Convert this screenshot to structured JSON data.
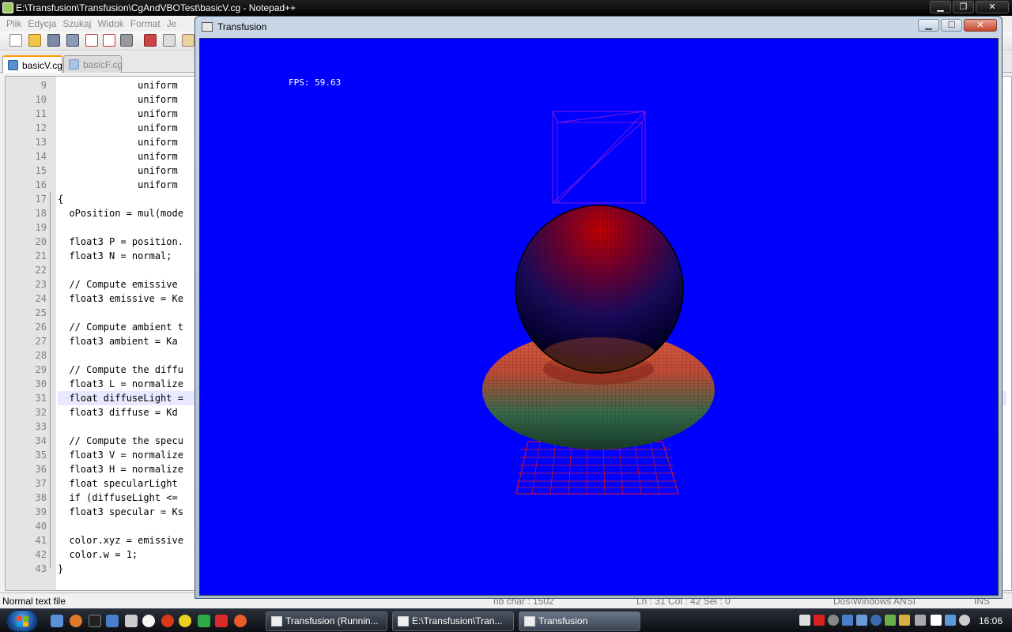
{
  "notepad": {
    "title": "E:\\Transfusion\\Transfusion\\CgAndVBOTest\\basicV.cg - Notepad++",
    "menu": [
      "Plik",
      "Edycja",
      "Szukaj",
      "Widok",
      "Format",
      "Je"
    ],
    "tabs": [
      {
        "label": "basicV.cg",
        "active": true
      },
      {
        "label": "basicF.cg",
        "active": false
      }
    ],
    "lines": [
      {
        "n": "9",
        "text": "              uniform"
      },
      {
        "n": "10",
        "text": "              uniform"
      },
      {
        "n": "11",
        "text": "              uniform"
      },
      {
        "n": "12",
        "text": "              uniform"
      },
      {
        "n": "13",
        "text": "              uniform"
      },
      {
        "n": "14",
        "text": "              uniform"
      },
      {
        "n": "15",
        "text": "              uniform"
      },
      {
        "n": "16",
        "text": "              uniform"
      },
      {
        "n": "17",
        "text": "{"
      },
      {
        "n": "18",
        "text": "  oPosition = mul(mode"
      },
      {
        "n": "19",
        "text": ""
      },
      {
        "n": "20",
        "text": "  float3 P = position."
      },
      {
        "n": "21",
        "text": "  float3 N = normal;"
      },
      {
        "n": "22",
        "text": ""
      },
      {
        "n": "23",
        "text": "  // Compute emissive"
      },
      {
        "n": "24",
        "text": "  float3 emissive = Ke"
      },
      {
        "n": "25",
        "text": ""
      },
      {
        "n": "26",
        "text": "  // Compute ambient t"
      },
      {
        "n": "27",
        "text": "  float3 ambient = Ka"
      },
      {
        "n": "28",
        "text": ""
      },
      {
        "n": "29",
        "text": "  // Compute the diffu"
      },
      {
        "n": "30",
        "text": "  float3 L = normalize"
      },
      {
        "n": "31",
        "text": "  float diffuseLight ="
      },
      {
        "n": "32",
        "text": "  float3 diffuse = Kd"
      },
      {
        "n": "33",
        "text": ""
      },
      {
        "n": "34",
        "text": "  // Compute the specu"
      },
      {
        "n": "35",
        "text": "  float3 V = normalize"
      },
      {
        "n": "36",
        "text": "  float3 H = normalize"
      },
      {
        "n": "37",
        "text": "  float specularLight"
      },
      {
        "n": "38",
        "text": "  if (diffuseLight <="
      },
      {
        "n": "39",
        "text": "  float3 specular = Ks"
      },
      {
        "n": "40",
        "text": ""
      },
      {
        "n": "41",
        "text": "  color.xyz = emissive"
      },
      {
        "n": "42",
        "text": "  color.w = 1;"
      },
      {
        "n": "43",
        "text": "}"
      }
    ],
    "current_line": "31",
    "status": {
      "type": "Normal text file",
      "chars": "nb char : 1502",
      "position": "Ln : 31    Col : 42    Sel : 0",
      "encoding": "Dos\\Windows  ANSI",
      "mode": "INS"
    }
  },
  "transfusion": {
    "title": "Transfusion",
    "fps": "FPS: 59.63",
    "background": "#0000ff"
  },
  "taskbar": {
    "tasks": [
      {
        "label": "Transfusion (Runnin...",
        "active": false
      },
      {
        "label": "E:\\Transfusion\\Tran...",
        "active": false
      },
      {
        "label": "Transfusion",
        "active": true
      }
    ],
    "clock": "16:06"
  }
}
